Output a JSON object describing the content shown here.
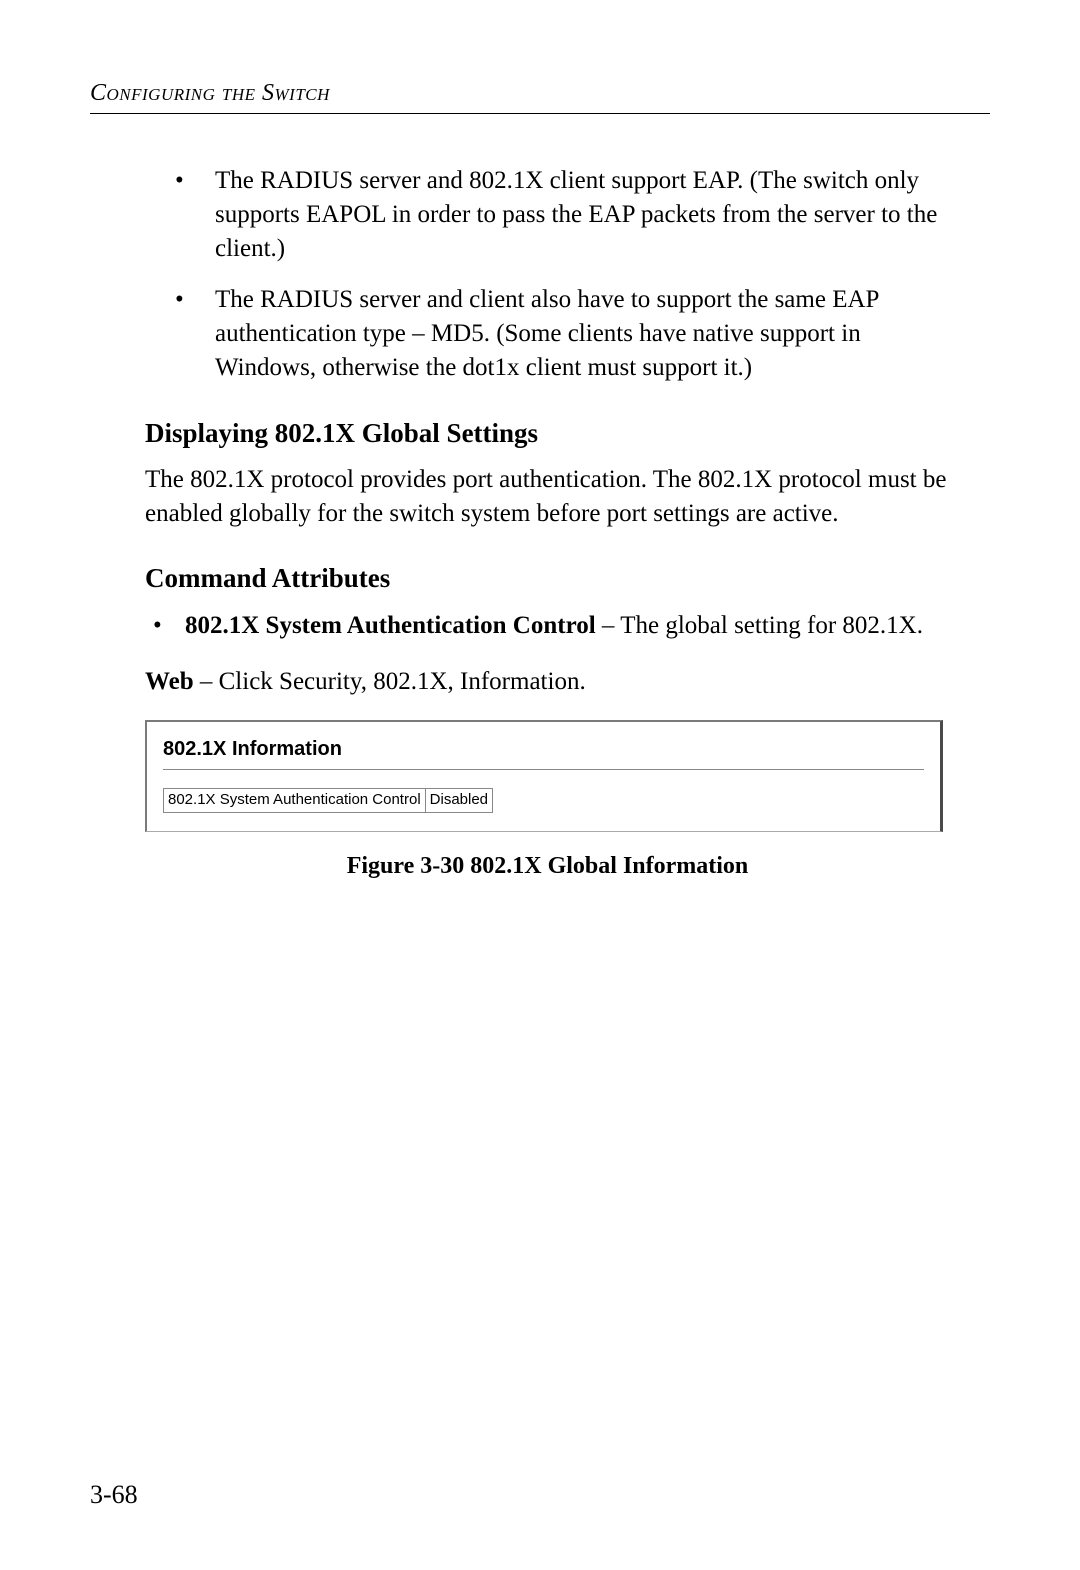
{
  "header": {
    "running_head": "Configuring the Switch"
  },
  "bullets_top": [
    "The RADIUS server and 802.1X client support EAP. (The switch only supports EAPOL in order to pass the EAP packets from the server to the client.)",
    "The RADIUS server and client also have to support the same EAP authentication type – MD5. (Some clients have native support in Windows, otherwise the dot1x client must support it.)"
  ],
  "section1": {
    "heading": "Displaying 802.1X Global Settings",
    "para": "The 802.1X protocol provides port authentication. The 802.1X protocol must be enabled globally for the switch system before port settings are active."
  },
  "section2": {
    "heading": "Command Attributes",
    "attr_bold": "802.1X System Authentication Control",
    "attr_rest": " – The global setting for 802.1X."
  },
  "web_line": {
    "label": "Web",
    "rest": " – Click Security, 802.1X, Information."
  },
  "figure": {
    "panel_title": "802.1X Information",
    "row_label": "802.1X System Authentication Control",
    "row_value": "Disabled",
    "caption": "Figure 3-30  802.1X Global Information"
  },
  "page_number": "3-68"
}
